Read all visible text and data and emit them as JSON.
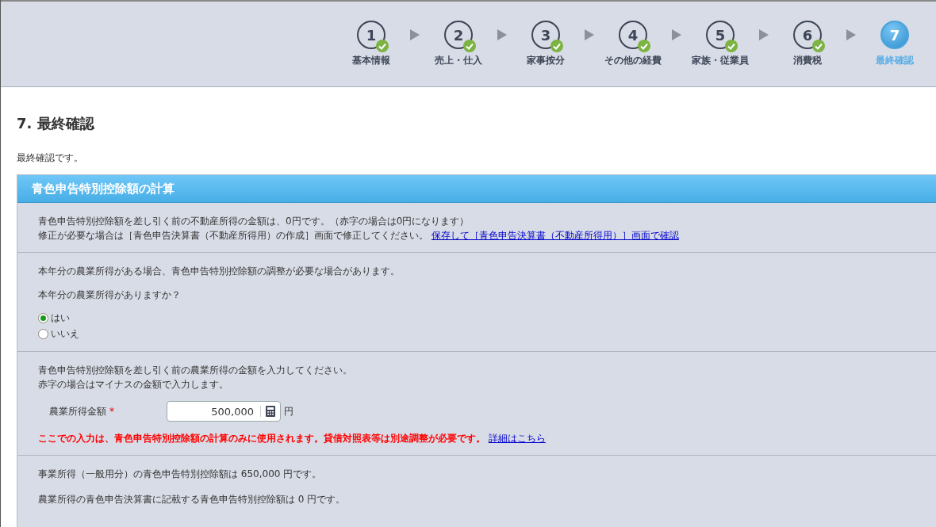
{
  "steps": [
    {
      "number": "1",
      "label": "基本情報",
      "done": true,
      "selected": false
    },
    {
      "number": "2",
      "label": "売上・仕入",
      "done": true,
      "selected": false
    },
    {
      "number": "3",
      "label": "家事按分",
      "done": true,
      "selected": false
    },
    {
      "number": "4",
      "label": "その他の経費",
      "done": true,
      "selected": false
    },
    {
      "number": "5",
      "label": "家族・従業員",
      "done": true,
      "selected": false
    },
    {
      "number": "6",
      "label": "消費税",
      "done": true,
      "selected": false
    },
    {
      "number": "7",
      "label": "最終確認",
      "done": false,
      "selected": true
    }
  ],
  "page": {
    "title": "7. 最終確認",
    "intro": "最終確認です。"
  },
  "panel": {
    "title": "青色申告特別控除額の計算",
    "real_estate": {
      "line1": "青色申告特別控除額を差し引く前の不動産所得の金額は、0円です。（赤字の場合は0円になります）",
      "line2": "修正が必要な場合は［青色申告決算書（不動産所得用）の作成］画面で修正してください。",
      "link": "保存して［青色申告決算書（不動産所得用）］画面で確認"
    },
    "farm_question": {
      "note": "本年分の農業所得がある場合、青色申告特別控除額の調整が必要な場合があります。",
      "question": "本年分の農業所得がありますか？",
      "options": [
        {
          "label": "はい",
          "selected": true
        },
        {
          "label": "いいえ",
          "selected": false
        }
      ]
    },
    "farm_amount": {
      "line1": "青色申告特別控除額を差し引く前の農業所得の金額を入力してください。",
      "line2": "赤字の場合はマイナスの金額で入力します。",
      "field_label": "農業所得金額",
      "required_mark": "*",
      "value": "500,000",
      "unit": "円",
      "warning": "ここでの入力は、青色申告特別控除額の計算のみに使用されます。貸借対照表等は別途調整が必要です。",
      "link": "詳細はこちら"
    },
    "results": [
      "事業所得（一般用分）の青色申告特別控除額は 650,000 円です。",
      "農業所得の青色申告決算書に記載する青色申告特別控除額は 0 円です。"
    ]
  }
}
